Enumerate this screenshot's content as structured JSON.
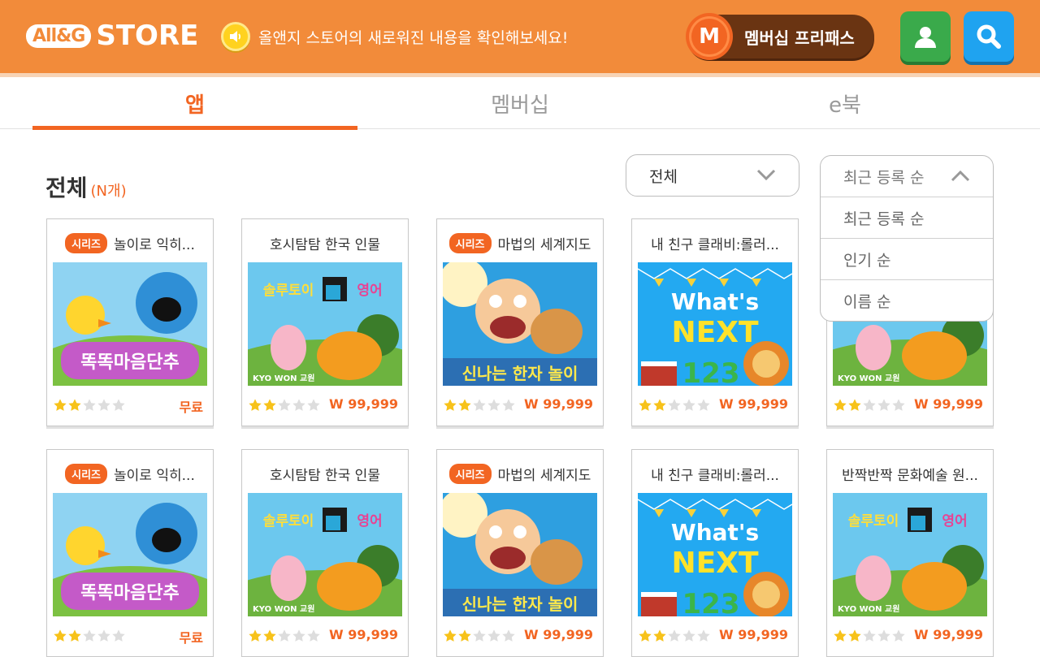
{
  "header": {
    "logo_badge": "All&G",
    "logo_text": "STORE",
    "notice": "올앤지 스토어의 새로워진 내용을 확인해보세요!",
    "membership_initial": "M",
    "membership_label": "멤버십 프리패스"
  },
  "tabs": [
    {
      "label": "앱",
      "active": true
    },
    {
      "label": "멤버십",
      "active": false
    },
    {
      "label": "e북",
      "active": false
    }
  ],
  "section": {
    "title": "전체",
    "count": "(N개)"
  },
  "filter": {
    "selected": "전체"
  },
  "sort": {
    "selected": "최근 등록 순",
    "options": [
      "최근 등록 순",
      "인기 순",
      "이름 순"
    ]
  },
  "cards": [
    {
      "series": "시리즈",
      "title": "놀이로 익히...",
      "thumb": "dandan",
      "rating": 2,
      "price": "무료"
    },
    {
      "series": "",
      "title": "호시탐탐 한국 인물",
      "thumb": "english",
      "rating": 2,
      "price": "W 99,999"
    },
    {
      "series": "시리즈",
      "title": "마법의 세계지도",
      "thumb": "hanja",
      "rating": 2,
      "price": "W 99,999"
    },
    {
      "series": "",
      "title": "내 친구 클래비:롤러...",
      "thumb": "next",
      "rating": 2,
      "price": "W 99,999"
    },
    {
      "series": "",
      "title": "",
      "thumb": "english",
      "rating": 2,
      "price": "W 99,999"
    },
    {
      "series": "시리즈",
      "title": "놀이로 익히...",
      "thumb": "dandan",
      "rating": 2,
      "price": "무료"
    },
    {
      "series": "",
      "title": "호시탐탐 한국 인물",
      "thumb": "english",
      "rating": 2,
      "price": "W 99,999"
    },
    {
      "series": "시리즈",
      "title": "마법의 세계지도",
      "thumb": "hanja",
      "rating": 2,
      "price": "W 99,999"
    },
    {
      "series": "",
      "title": "내 친구 클래비:롤러...",
      "thumb": "next",
      "rating": 2,
      "price": "W 99,999"
    },
    {
      "series": "",
      "title": "반짝반짝 문화예술 원...",
      "thumb": "english",
      "rating": 2,
      "price": "W 99,999"
    }
  ],
  "thumb_text": {
    "dandan": "똑똑마음단추",
    "english": "솔루토이 영어",
    "english_brand": "KYO WON 교원",
    "hanja": "신나는 한자 놀이",
    "next_line1": "What's",
    "next_line2": "NEXT",
    "next_numbers": "123"
  },
  "colors": {
    "header": "#f28b3a",
    "accent": "#f26522",
    "user_button": "#3aaa4b",
    "search_button": "#1fa3f0",
    "star_on": "#f7c21a",
    "star_off": "#dddddd"
  },
  "icons": {
    "speaker": "speaker-icon",
    "user": "user-icon",
    "search": "search-icon",
    "chevron_down": "chevron-down-icon",
    "chevron_up": "chevron-up-icon",
    "star": "star-icon"
  }
}
